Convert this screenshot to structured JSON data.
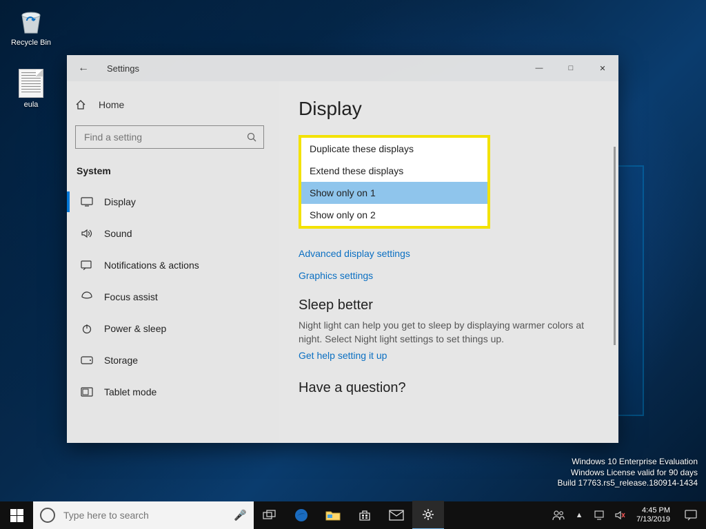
{
  "desktop": {
    "recycle_bin_label": "Recycle Bin",
    "eula_label": "eula"
  },
  "settings": {
    "title": "Settings",
    "home_label": "Home",
    "search_placeholder": "Find a setting",
    "section_label": "System",
    "items": [
      {
        "label": "Display"
      },
      {
        "label": "Sound"
      },
      {
        "label": "Notifications & actions"
      },
      {
        "label": "Focus assist"
      },
      {
        "label": "Power & sleep"
      },
      {
        "label": "Storage"
      },
      {
        "label": "Tablet mode"
      }
    ],
    "page_heading": "Display",
    "dropdown_options": [
      "Duplicate these displays",
      "Extend these displays",
      "Show only on 1",
      "Show only on 2"
    ],
    "dropdown_selected_index": 2,
    "advanced_link": "Advanced display settings",
    "graphics_link": "Graphics settings",
    "sleep": {
      "heading": "Sleep better",
      "body": "Night light can help you get to sleep by displaying warmer colors at night. Select Night light settings to set things up.",
      "help_link": "Get help setting it up"
    },
    "question_heading": "Have a question?"
  },
  "watermark": {
    "line1": "Windows 10 Enterprise Evaluation",
    "line2": "Windows License valid for 90 days",
    "line3": "Build 17763.rs5_release.180914-1434"
  },
  "taskbar": {
    "search_placeholder": "Type here to search",
    "time": "4:45 PM",
    "date": "7/13/2019"
  }
}
